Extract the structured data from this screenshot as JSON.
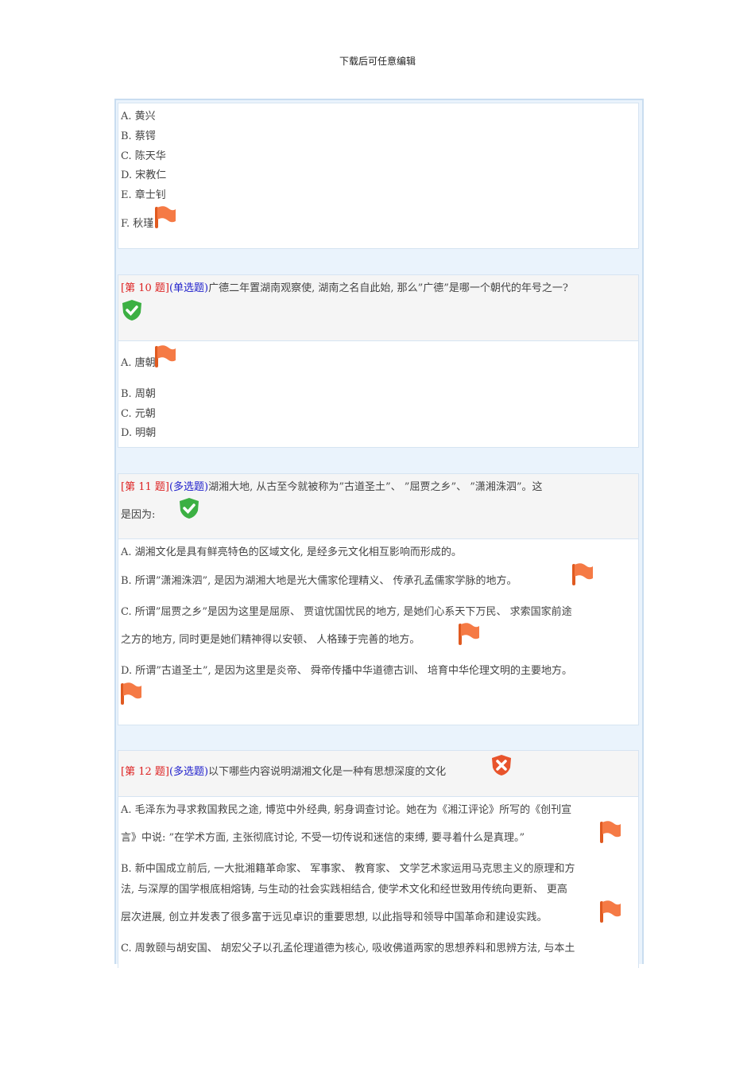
{
  "header": "下载后可任意编辑",
  "q9": {
    "options": [
      "A. 黄兴",
      "B. 蔡锷",
      "C. 陈天华",
      "D. 宋教仁",
      "E. 章士钊",
      "F. 秋瑾"
    ]
  },
  "q10": {
    "num": "[第 10 题]",
    "type": "(单选题)",
    "text": "广德二年置湖南观察使, 湖南之名自此始, 那么”广德”是哪一个朝代的年号之一?",
    "result": "correct",
    "options": [
      "A. 唐朝",
      "B. 周朝",
      "C. 元朝",
      "D. 明朝"
    ]
  },
  "q11": {
    "num": "[第 11 题]",
    "type": "(多选题)",
    "text1": "湖湘大地, 从古至今就被称为”古道圣土”、  ”屈贾之乡”、  ”潇湘洙泗”。这",
    "text2": "是因为:",
    "result": "correct",
    "options": [
      "A. 湖湘文化是具有鲜亮特色的区域文化, 是经多元文化相互影响而形成的。",
      "B. 所谓”潇湘洙泗”, 是因为湖湘大地是光大儒家伦理精义、 传承孔孟儒家学脉的地方。",
      "C. 所谓”屈贾之乡”是因为这里是屈原、 贾谊忧国忧民的地方, 是她们心系天下万民、 求索国家前途",
      "之方的地方, 同时更是她们精神得以安顿、 人格臻于完善的地方。",
      "D. 所谓”古道圣土”, 是因为这里是炎帝、 舜帝传播中华道德古训、 培育中华伦理文明的主要地方。"
    ]
  },
  "q12": {
    "num": "[第 12 题]",
    "type": "(多选题)",
    "text": "以下哪些内容说明湖湘文化是一种有思想深度的文化",
    "result": "wrong",
    "options": [
      "A. 毛泽东为寻求救国救民之途, 博览中外经典, 躬身调查讨论。她在为《湘江评论》所写的《创刊宣",
      "言》中说: ”在学术方面, 主张彻底讨论, 不受一切传说和迷信的束缚, 要寻着什么是真理。”",
      "B. 新中国成立前后, 一大批湘籍革命家、 军事家、 教育家、 文学艺术家运用马克思主义的原理和方",
      "法, 与深厚的国学根底相熔铸, 与生动的社会实践相结合, 使学术文化和经世致用传统向更新、 更高",
      "层次进展, 创立并发表了很多富于远见卓识的重要思想, 以此指导和领导中国革命和建设实践。",
      "C. 周敦颐与胡安国、 胡宏父子以孔孟伦理道德为核心, 吸收佛道两家的思想养料和思辨方法, 与本土"
    ]
  },
  "colors": {
    "flag": "#f06a30",
    "check": "#3cb043",
    "cross": "#e8542c"
  }
}
